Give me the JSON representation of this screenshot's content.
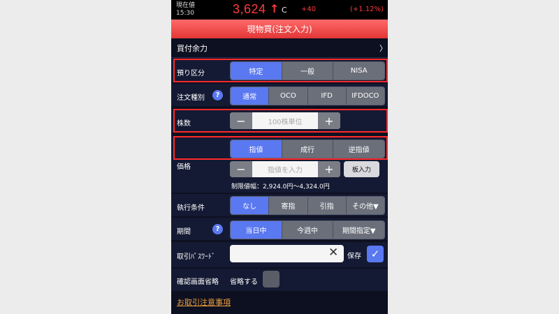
{
  "price_bar": {
    "current_label": "現在値",
    "time": "15:30",
    "price": "3,624",
    "arrow": "↑",
    "flag": "C",
    "change": "+40",
    "change_pct": "(+1.12%)"
  },
  "header": {
    "title": "現物買(注文入力)"
  },
  "buying_power": {
    "label": "買付余力",
    "chevron": "〉"
  },
  "deposit": {
    "label": "預り区分",
    "options": [
      "特定",
      "一般",
      "NISA"
    ],
    "selected": "特定"
  },
  "order_type": {
    "label": "注文種別",
    "help": "?",
    "options": [
      "通常",
      "OCO",
      "IFD",
      "IFDOCO"
    ],
    "selected": "通常"
  },
  "shares": {
    "label": "株数",
    "minus": "−",
    "plus": "+",
    "placeholder": "100株単位"
  },
  "price_type": {
    "options": [
      "指値",
      "成行",
      "逆指値"
    ],
    "selected": "指値"
  },
  "price": {
    "label": "価格",
    "minus": "−",
    "plus": "+",
    "placeholder": "指値を入力",
    "board_button": "板入力",
    "limit_range": "制限値幅：2,924.0円〜4,324.0円"
  },
  "condition": {
    "label": "執行条件",
    "options": [
      "なし",
      "寄指",
      "引指",
      "その他▼"
    ],
    "selected": "なし"
  },
  "period": {
    "label": "期間",
    "help": "?",
    "options": [
      "当日中",
      "今週中",
      "期間指定▼"
    ],
    "selected": "当日中"
  },
  "password": {
    "label": "取引ﾊﾟｽﾜｰﾄﾞ",
    "clear": "✕",
    "save_label": "保存",
    "check": "✓"
  },
  "confirm": {
    "label": "確認画面省略",
    "checkbox_label": "省略する"
  },
  "notes_link": "お取引注意事項",
  "colors": {
    "accent": "#5a78f0",
    "header": "#e23636",
    "price": "#ff3b3b",
    "highlight": "#ff2a2a"
  }
}
